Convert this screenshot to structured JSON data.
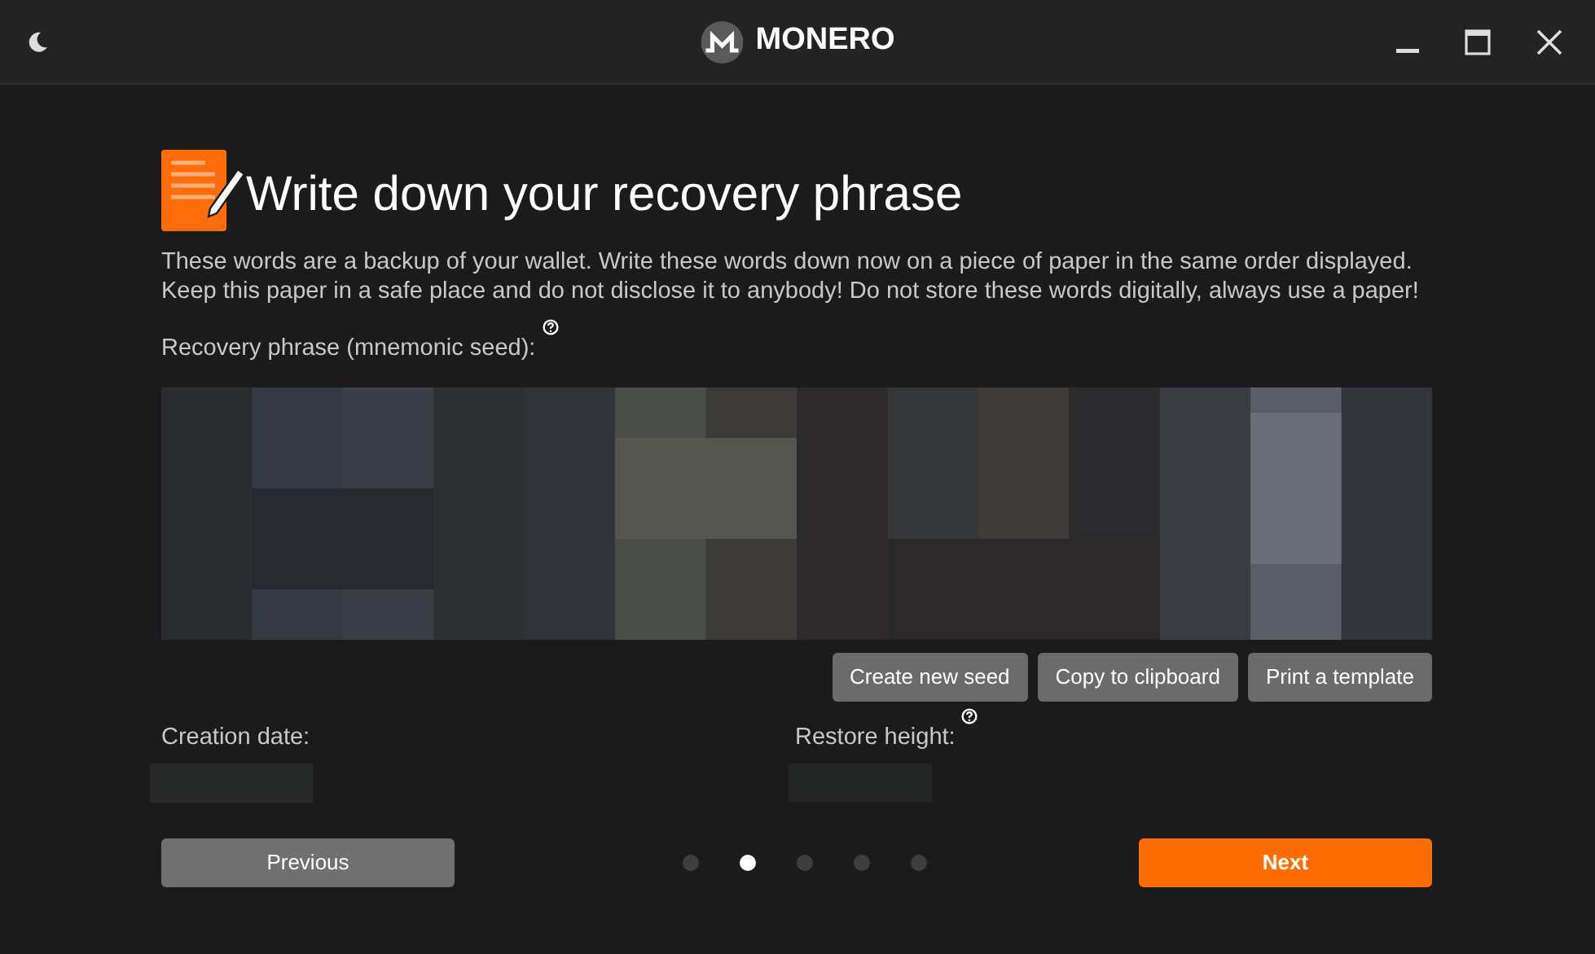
{
  "window": {
    "title": "MONERO"
  },
  "heading": "Write down your recovery phrase",
  "description": "These words are a backup of your wallet. Write these words down now on a piece of paper in the same order displayed. Keep this paper in a safe place and do not disclose it to anybody! Do not store these words digitally, always use a paper!",
  "seed": {
    "label": "Recovery phrase (mnemonic seed):"
  },
  "seed_buttons": [
    "Create new seed",
    "Copy to clipboard",
    "Print a template"
  ],
  "creation_date": {
    "label": "Creation date:"
  },
  "restore_height": {
    "label": "Restore height:"
  },
  "navigation": {
    "previous": "Previous",
    "next": "Next",
    "pages": [
      {
        "selected": false
      },
      {
        "selected": true
      },
      {
        "selected": false
      },
      {
        "selected": false
      },
      {
        "selected": false
      }
    ]
  }
}
